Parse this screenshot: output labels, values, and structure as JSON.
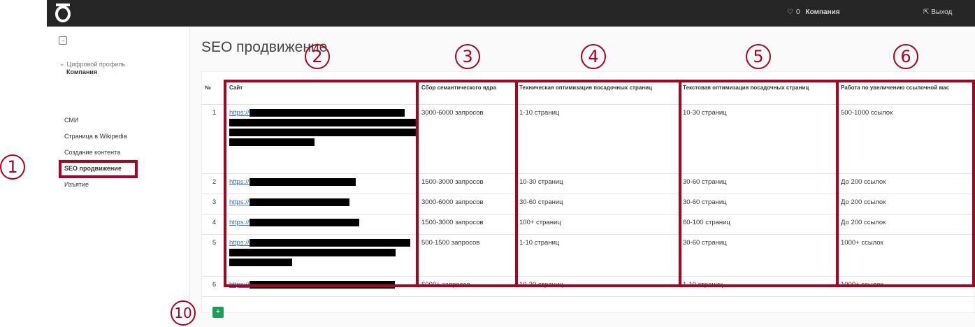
{
  "topbar": {
    "notifications": "0",
    "company": "Компания",
    "logout": "Выход"
  },
  "sidebar": {
    "profile_label": "Цифровой профиль",
    "profile_company": "Компания",
    "items": [
      {
        "label": "СМИ"
      },
      {
        "label": "Страница в Wikipedia"
      },
      {
        "label": "Создание контента"
      },
      {
        "label": "SEO продвижение",
        "active": true
      },
      {
        "label": "Изъятие"
      }
    ]
  },
  "page": {
    "title": "SEO продвижение"
  },
  "table": {
    "headers": [
      "№",
      "Сайт",
      "Сбор семантического ядра",
      "Техническая оптимизация посадочных страниц",
      "Текстовая оптимизация посадочных страниц",
      "Работа по увеличению ссылочной мас"
    ],
    "rows": [
      {
        "n": "1",
        "site": "https://",
        "semantic": "3000-6000 запросов",
        "tech": "1-10 страниц",
        "text": "10-30 страниц",
        "links": "500-1000 ссылок"
      },
      {
        "n": "2",
        "site": "https://",
        "semantic": "1500-3000 запросов",
        "tech": "10-30 страниц",
        "text": "30-60 страниц",
        "links": "До 200 ссылок"
      },
      {
        "n": "3",
        "site": "https://",
        "semantic": "3000-6000 запросов",
        "tech": "30-60 страниц",
        "text": "30-60 страниц",
        "links": "До 200 ссылок"
      },
      {
        "n": "4",
        "site": "https://",
        "semantic": "1500-3000 запросов",
        "tech": "100+ страниц",
        "text": "60-100 страниц",
        "links": "До 200 ссылок"
      },
      {
        "n": "5",
        "site": "https://",
        "semantic": "500-1500 запросов",
        "tech": "1-10 страниц",
        "text": "30-60 страниц",
        "links": "1000+ ссылок"
      },
      {
        "n": "6",
        "site": "https://",
        "semantic": "6000+ запросов",
        "tech": "10-30 страниц",
        "text": "1-10 страниц",
        "links": "1000+ ссылок"
      }
    ]
  },
  "add_button": "+",
  "annotations": [
    "1",
    "2",
    "3",
    "4",
    "5",
    "6",
    "10"
  ],
  "colors": {
    "annotation": "#b00020",
    "topbar": "#262626",
    "add_button": "#1e9e57",
    "link": "#3a6fc9"
  }
}
